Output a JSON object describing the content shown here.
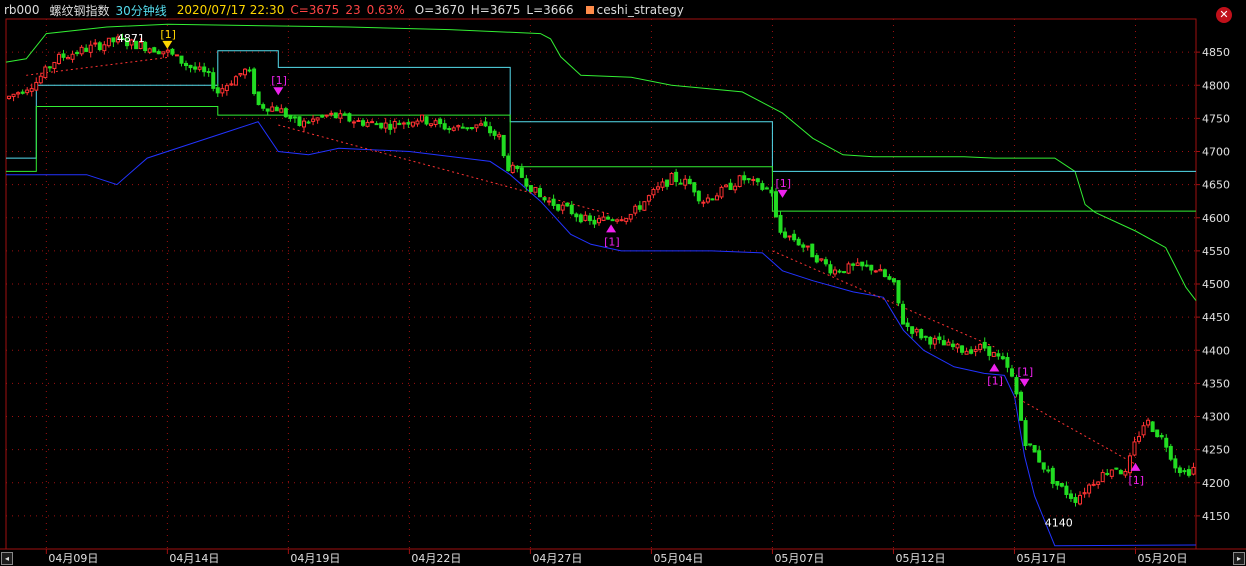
{
  "header": {
    "symbol": "rb000",
    "name": "螺纹钢指数",
    "period": "30分钟线",
    "datetime": "2020/07/17 22:30",
    "close": "C=3675",
    "change": "23",
    "change_pct": "0.63%",
    "open": "O=3670",
    "high": "H=3675",
    "low": "L=3666",
    "strategy": "ceshi_strategy"
  },
  "colors": {
    "up": "#ff3333",
    "down": "#22dd22",
    "upper_channel": "#33ee33",
    "mid_channel": "#55ddee",
    "lower_channel": "#2233ff",
    "signal": "#ee22ee",
    "trend": "#ff3333",
    "grid": "#a01010",
    "axis_text": "#e0e0e0",
    "header_cyan": "#55ddee",
    "header_yellow": "#ffd700",
    "header_red": "#ff4444"
  },
  "icons": {
    "close": "close-icon",
    "scroll_left": "scroll-left-icon",
    "scroll_right": "scroll-right-icon"
  },
  "chart_data": {
    "type": "candlestick",
    "ylim": [
      4100,
      4900
    ],
    "yticks": [
      4850,
      4800,
      4750,
      4700,
      4650,
      4600,
      4550,
      4500,
      4450,
      4400,
      4350,
      4300,
      4250,
      4200,
      4150
    ],
    "xlim": [
      0,
      118
    ],
    "xticks": [
      {
        "x": 4,
        "label": "04月09日"
      },
      {
        "x": 16,
        "label": "04月14日"
      },
      {
        "x": 28,
        "label": "04月19日"
      },
      {
        "x": 40,
        "label": "04月22日"
      },
      {
        "x": 52,
        "label": "04月27日"
      },
      {
        "x": 64,
        "label": "05月04日"
      },
      {
        "x": 76,
        "label": "05月07日"
      },
      {
        "x": 88,
        "label": "05月12日"
      },
      {
        "x": 100,
        "label": "05月17日"
      },
      {
        "x": 112,
        "label": "05月20日"
      }
    ],
    "close_path": [
      [
        0,
        4780
      ],
      [
        3,
        4805
      ],
      [
        5,
        4840
      ],
      [
        8,
        4855
      ],
      [
        11,
        4868
      ],
      [
        14,
        4858
      ],
      [
        16,
        4850
      ],
      [
        18,
        4830
      ],
      [
        20,
        4815
      ],
      [
        21,
        4790
      ],
      [
        23,
        4815
      ],
      [
        24,
        4825
      ],
      [
        25,
        4770
      ],
      [
        27,
        4765
      ],
      [
        29,
        4740
      ],
      [
        32,
        4755
      ],
      [
        35,
        4745
      ],
      [
        38,
        4740
      ],
      [
        41,
        4750
      ],
      [
        44,
        4735
      ],
      [
        47,
        4740
      ],
      [
        49,
        4720
      ],
      [
        49.5,
        4680
      ],
      [
        51,
        4665
      ],
      [
        53,
        4630
      ],
      [
        56,
        4610
      ],
      [
        58,
        4592
      ],
      [
        60,
        4600
      ],
      [
        62,
        4605
      ],
      [
        64,
        4635
      ],
      [
        66,
        4660
      ],
      [
        68,
        4650
      ],
      [
        69,
        4625
      ],
      [
        71,
        4640
      ],
      [
        73,
        4660
      ],
      [
        75,
        4645
      ],
      [
        76,
        4640
      ],
      [
        76.5,
        4580
      ],
      [
        78,
        4570
      ],
      [
        80,
        4545
      ],
      [
        82,
        4520
      ],
      [
        84,
        4525
      ],
      [
        86,
        4525
      ],
      [
        88,
        4500
      ],
      [
        89,
        4440
      ],
      [
        91,
        4420
      ],
      [
        93,
        4408
      ],
      [
        95,
        4400
      ],
      [
        97,
        4405
      ],
      [
        99,
        4380
      ],
      [
        100,
        4350
      ],
      [
        101,
        4265
      ],
      [
        102,
        4245
      ],
      [
        104,
        4200
      ],
      [
        106,
        4175
      ],
      [
        108,
        4205
      ],
      [
        110,
        4225
      ],
      [
        111,
        4212
      ],
      [
        112,
        4262
      ],
      [
        113,
        4295
      ],
      [
        115,
        4260
      ],
      [
        116,
        4225
      ],
      [
        117,
        4215
      ],
      [
        118,
        4225
      ]
    ],
    "candle_seed": 7,
    "upper_channel": [
      [
        0,
        4835
      ],
      [
        2,
        4840
      ],
      [
        4,
        4878
      ],
      [
        10,
        4888
      ],
      [
        16,
        4892
      ],
      [
        34,
        4888
      ],
      [
        44,
        4884
      ],
      [
        53,
        4878
      ],
      [
        54,
        4870
      ],
      [
        55,
        4843
      ],
      [
        57,
        4815
      ],
      [
        62,
        4812
      ],
      [
        66,
        4800
      ],
      [
        73,
        4790
      ],
      [
        77,
        4758
      ],
      [
        80,
        4720
      ],
      [
        83,
        4695
      ],
      [
        86,
        4692
      ],
      [
        95,
        4692
      ],
      [
        98,
        4690
      ],
      [
        104,
        4690
      ],
      [
        106,
        4670
      ],
      [
        107,
        4620
      ],
      [
        108,
        4608
      ],
      [
        112,
        4580
      ],
      [
        115,
        4555
      ],
      [
        116,
        4525
      ],
      [
        117,
        4495
      ],
      [
        118,
        4475
      ]
    ],
    "mid_channel": [
      [
        0,
        4690
      ],
      [
        0,
        4690
      ],
      [
        3,
        4690
      ],
      [
        3,
        4800
      ],
      [
        21,
        4800
      ],
      [
        21,
        4852
      ],
      [
        27,
        4852
      ],
      [
        27,
        4827
      ],
      [
        50,
        4827
      ],
      [
        50,
        4745
      ],
      [
        76,
        4745
      ],
      [
        76,
        4670
      ],
      [
        118,
        4670
      ]
    ],
    "mid_channel2": [
      [
        0,
        4670
      ],
      [
        3,
        4670
      ],
      [
        3,
        4768
      ],
      [
        21,
        4768
      ],
      [
        21,
        4755
      ],
      [
        50,
        4755
      ],
      [
        50,
        4677
      ],
      [
        76,
        4677
      ],
      [
        76,
        4610
      ],
      [
        118,
        4610
      ]
    ],
    "lower_channel": [
      [
        0,
        4665
      ],
      [
        8,
        4665
      ],
      [
        11,
        4650
      ],
      [
        14,
        4690
      ],
      [
        18,
        4710
      ],
      [
        22,
        4730
      ],
      [
        25,
        4745
      ],
      [
        27,
        4700
      ],
      [
        30,
        4695
      ],
      [
        33,
        4705
      ],
      [
        40,
        4700
      ],
      [
        48,
        4685
      ],
      [
        50,
        4665
      ],
      [
        53,
        4625
      ],
      [
        56,
        4575
      ],
      [
        58,
        4560
      ],
      [
        61,
        4550
      ],
      [
        70,
        4550
      ],
      [
        75,
        4547
      ],
      [
        77,
        4520
      ],
      [
        80,
        4505
      ],
      [
        84,
        4488
      ],
      [
        87,
        4480
      ],
      [
        89,
        4430
      ],
      [
        91,
        4400
      ],
      [
        94,
        4375
      ],
      [
        97,
        4365
      ],
      [
        99,
        4362
      ],
      [
        100,
        4330
      ],
      [
        101,
        4240
      ],
      [
        102,
        4180
      ],
      [
        104,
        4105
      ],
      [
        118,
        4106
      ]
    ],
    "trend_lines": [
      {
        "from": [
          2,
          4815
        ],
        "to": [
          16,
          4842
        ]
      },
      {
        "from": [
          27,
          4740
        ],
        "to": [
          60,
          4605
        ]
      },
      {
        "from": [
          76,
          4550
        ],
        "to": [
          98,
          4405
        ]
      },
      {
        "from": [
          100,
          4330
        ],
        "to": [
          112,
          4228
        ]
      }
    ],
    "signals": [
      {
        "x": 16,
        "y": 4855,
        "dir": "down",
        "label": "[1]",
        "color": "yellow"
      },
      {
        "x": 27,
        "y": 4785,
        "dir": "down",
        "label": "[1]",
        "color": "magenta"
      },
      {
        "x": 60,
        "y": 4590,
        "dir": "up",
        "label": "[1]",
        "color": "magenta"
      },
      {
        "x": 77,
        "y": 4630,
        "dir": "down",
        "label": "[1]",
        "color": "magenta"
      },
      {
        "x": 98,
        "y": 4380,
        "dir": "up",
        "label": "[1]",
        "color": "magenta"
      },
      {
        "x": 101,
        "y": 4345,
        "dir": "down",
        "label": "[1]",
        "color": "magenta"
      },
      {
        "x": 112,
        "y": 4230,
        "dir": "up",
        "label": "[1]",
        "color": "magenta"
      }
    ],
    "annotations": [
      {
        "x": 11,
        "y": 4871,
        "label": "4871"
      },
      {
        "x": 103,
        "y": 4140,
        "label": "4140"
      }
    ]
  }
}
